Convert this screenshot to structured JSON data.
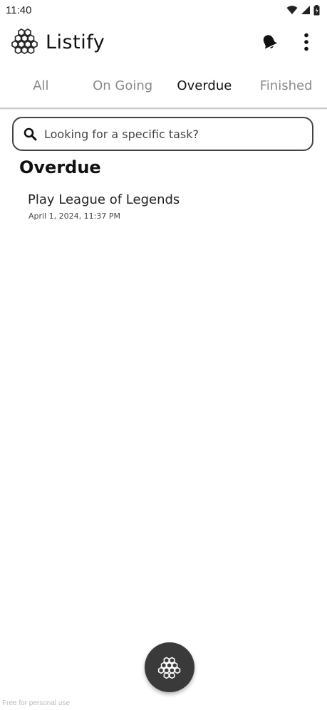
{
  "status_bar": {
    "time": "11:40",
    "icons": [
      "wifi-icon",
      "signal-icon",
      "battery-icon"
    ]
  },
  "app_bar": {
    "title": "Listify",
    "logo_icon": "honeycomb-logo-icon",
    "actions": [
      "bell-icon",
      "more-vert-icon"
    ]
  },
  "tabs": [
    {
      "label": "All",
      "active": false
    },
    {
      "label": "On Going",
      "active": false
    },
    {
      "label": "Overdue",
      "active": true
    },
    {
      "label": "Finished",
      "active": false
    }
  ],
  "search": {
    "placeholder": "Looking for a specific task?",
    "value": ""
  },
  "section": {
    "title": "Overdue",
    "tasks": [
      {
        "title": "Play League of Legends",
        "date": "April 1, 2024, 11:37 PM"
      }
    ]
  },
  "fab": {
    "icon": "honeycomb-icon"
  },
  "watermark": "Free for personal use",
  "colors": {
    "fab_background": "#3a3a3a",
    "inactive_tab": "#8a8a8a",
    "active_tab": "#111111"
  }
}
